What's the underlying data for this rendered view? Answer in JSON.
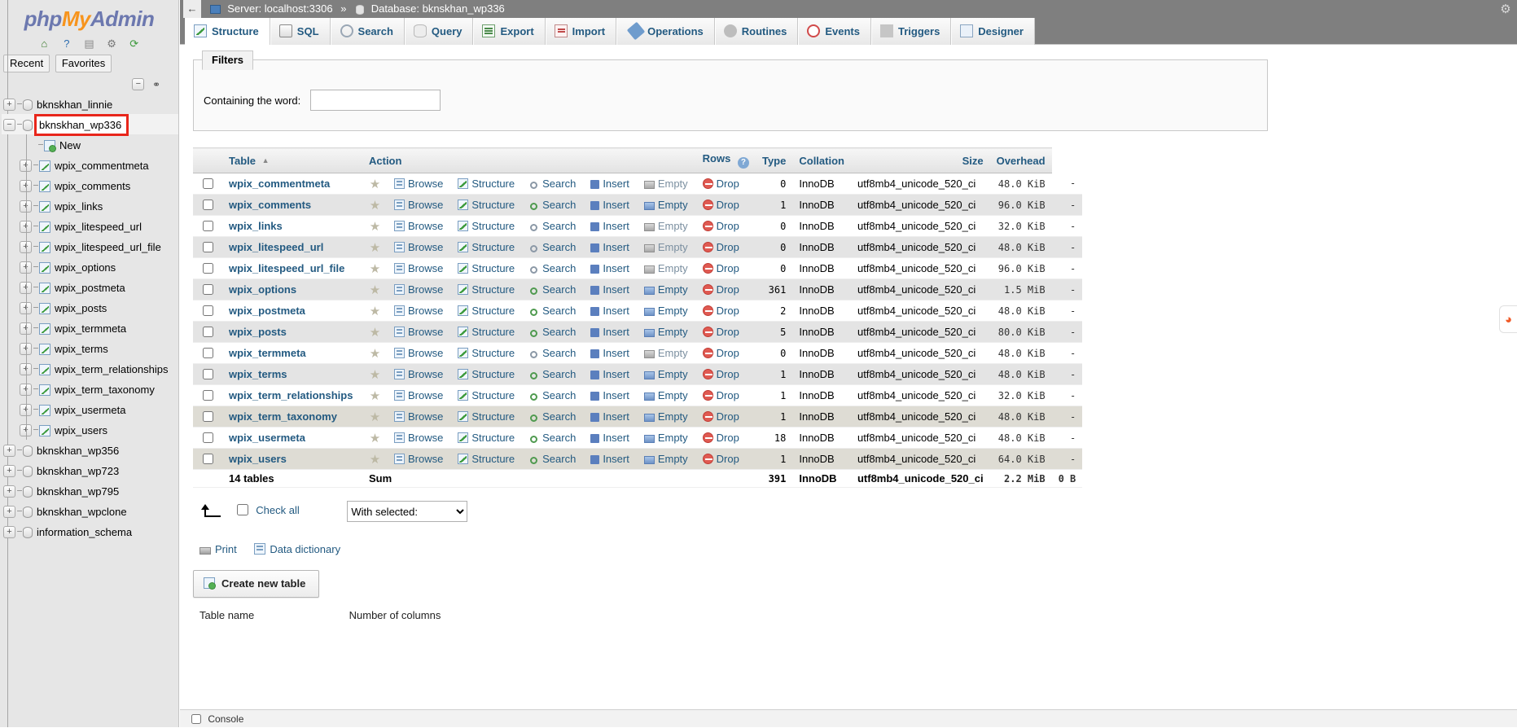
{
  "branding": {
    "logo_php": "php",
    "logo_my": "My",
    "logo_admin": "Admin"
  },
  "sidebar": {
    "icons": [
      {
        "name": "home-icon",
        "glyph": "⌂"
      },
      {
        "name": "help-icon",
        "glyph": "?"
      },
      {
        "name": "documentation-icon",
        "glyph": "▤"
      },
      {
        "name": "settings-gear-icon",
        "glyph": "⚙"
      },
      {
        "name": "reload-icon",
        "glyph": "⟳"
      }
    ],
    "tabs": [
      {
        "label": "Recent"
      },
      {
        "label": "Favorites"
      }
    ],
    "tree_controls": {
      "collapse_label": "−",
      "link_label": "⚭"
    },
    "tree": [
      {
        "label": "bknskhan_linnie",
        "level": 0,
        "expander": "+",
        "type": "db"
      },
      {
        "label": "bknskhan_wp336",
        "level": 0,
        "expander": "−",
        "type": "db",
        "highlight": true,
        "active": true
      },
      {
        "label": "New",
        "level": 1,
        "expander": "",
        "type": "new"
      },
      {
        "label": "wpix_commentmeta",
        "level": 1,
        "expander": "+",
        "type": "table"
      },
      {
        "label": "wpix_comments",
        "level": 1,
        "expander": "+",
        "type": "table"
      },
      {
        "label": "wpix_links",
        "level": 1,
        "expander": "+",
        "type": "table"
      },
      {
        "label": "wpix_litespeed_url",
        "level": 1,
        "expander": "+",
        "type": "table"
      },
      {
        "label": "wpix_litespeed_url_file",
        "level": 1,
        "expander": "+",
        "type": "table"
      },
      {
        "label": "wpix_options",
        "level": 1,
        "expander": "+",
        "type": "table"
      },
      {
        "label": "wpix_postmeta",
        "level": 1,
        "expander": "+",
        "type": "table"
      },
      {
        "label": "wpix_posts",
        "level": 1,
        "expander": "+",
        "type": "table"
      },
      {
        "label": "wpix_termmeta",
        "level": 1,
        "expander": "+",
        "type": "table"
      },
      {
        "label": "wpix_terms",
        "level": 1,
        "expander": "+",
        "type": "table"
      },
      {
        "label": "wpix_term_relationships",
        "level": 1,
        "expander": "+",
        "type": "table"
      },
      {
        "label": "wpix_term_taxonomy",
        "level": 1,
        "expander": "+",
        "type": "table"
      },
      {
        "label": "wpix_usermeta",
        "level": 1,
        "expander": "+",
        "type": "table"
      },
      {
        "label": "wpix_users",
        "level": 1,
        "expander": "+",
        "type": "table"
      },
      {
        "label": "bknskhan_wp356",
        "level": 0,
        "expander": "+",
        "type": "db"
      },
      {
        "label": "bknskhan_wp723",
        "level": 0,
        "expander": "+",
        "type": "db"
      },
      {
        "label": "bknskhan_wp795",
        "level": 0,
        "expander": "+",
        "type": "db"
      },
      {
        "label": "bknskhan_wpclone",
        "level": 0,
        "expander": "+",
        "type": "db"
      },
      {
        "label": "information_schema",
        "level": 0,
        "expander": "+",
        "type": "db"
      }
    ]
  },
  "breadcrumb": {
    "back_glyph": "←",
    "server": "Server: localhost:3306",
    "separator": "»",
    "database": "Database: bknskhan_wp336"
  },
  "navtabs": [
    {
      "label": "Structure",
      "icon": "structure-icon",
      "active": true
    },
    {
      "label": "SQL",
      "icon": "sql-icon",
      "active": false
    },
    {
      "label": "Search",
      "icon": "search-icon",
      "active": false
    },
    {
      "label": "Query",
      "icon": "query-icon",
      "active": false
    },
    {
      "label": "Export",
      "icon": "export-icon",
      "active": false
    },
    {
      "label": "Import",
      "icon": "import-icon",
      "active": false
    },
    {
      "label": "Operations",
      "icon": "operations-icon",
      "active": false
    },
    {
      "label": "Routines",
      "icon": "routines-icon",
      "active": false
    },
    {
      "label": "Events",
      "icon": "events-icon",
      "active": false
    },
    {
      "label": "Triggers",
      "icon": "triggers-icon",
      "active": false
    },
    {
      "label": "Designer",
      "icon": "designer-icon",
      "active": false
    }
  ],
  "filters": {
    "legend": "Filters",
    "containing_label": "Containing the word:",
    "containing_value": "",
    "containing_placeholder": ""
  },
  "tables_table": {
    "headers": {
      "table": "Table",
      "sort_arrow": "▲",
      "action": "Action",
      "rows": "Rows",
      "rows_help": "?",
      "type": "Type",
      "collation": "Collation",
      "size": "Size",
      "overhead": "Overhead"
    },
    "actions": {
      "browse": "Browse",
      "structure": "Structure",
      "search": "Search",
      "insert": "Insert",
      "empty": "Empty",
      "drop": "Drop",
      "star": "★"
    },
    "rows": [
      {
        "name": "wpix_commentmeta",
        "rows": "0",
        "type": "InnoDB",
        "collation": "utf8mb4_unicode_520_ci",
        "size": "48.0 KiB",
        "overhead": "-",
        "empty_active": false,
        "search_active": false
      },
      {
        "name": "wpix_comments",
        "rows": "1",
        "type": "InnoDB",
        "collation": "utf8mb4_unicode_520_ci",
        "size": "96.0 KiB",
        "overhead": "-",
        "empty_active": true,
        "search_active": true
      },
      {
        "name": "wpix_links",
        "rows": "0",
        "type": "InnoDB",
        "collation": "utf8mb4_unicode_520_ci",
        "size": "32.0 KiB",
        "overhead": "-",
        "empty_active": false,
        "search_active": false
      },
      {
        "name": "wpix_litespeed_url",
        "rows": "0",
        "type": "InnoDB",
        "collation": "utf8mb4_unicode_520_ci",
        "size": "48.0 KiB",
        "overhead": "-",
        "empty_active": false,
        "search_active": false
      },
      {
        "name": "wpix_litespeed_url_file",
        "rows": "0",
        "type": "InnoDB",
        "collation": "utf8mb4_unicode_520_ci",
        "size": "96.0 KiB",
        "overhead": "-",
        "empty_active": false,
        "search_active": false
      },
      {
        "name": "wpix_options",
        "rows": "361",
        "type": "InnoDB",
        "collation": "utf8mb4_unicode_520_ci",
        "size": "1.5 MiB",
        "overhead": "-",
        "empty_active": true,
        "search_active": true
      },
      {
        "name": "wpix_postmeta",
        "rows": "2",
        "type": "InnoDB",
        "collation": "utf8mb4_unicode_520_ci",
        "size": "48.0 KiB",
        "overhead": "-",
        "empty_active": true,
        "search_active": true
      },
      {
        "name": "wpix_posts",
        "rows": "5",
        "type": "InnoDB",
        "collation": "utf8mb4_unicode_520_ci",
        "size": "80.0 KiB",
        "overhead": "-",
        "empty_active": true,
        "search_active": true
      },
      {
        "name": "wpix_termmeta",
        "rows": "0",
        "type": "InnoDB",
        "collation": "utf8mb4_unicode_520_ci",
        "size": "48.0 KiB",
        "overhead": "-",
        "empty_active": false,
        "search_active": false
      },
      {
        "name": "wpix_terms",
        "rows": "1",
        "type": "InnoDB",
        "collation": "utf8mb4_unicode_520_ci",
        "size": "48.0 KiB",
        "overhead": "-",
        "empty_active": true,
        "search_active": true
      },
      {
        "name": "wpix_term_relationships",
        "rows": "1",
        "type": "InnoDB",
        "collation": "utf8mb4_unicode_520_ci",
        "size": "32.0 KiB",
        "overhead": "-",
        "empty_active": true,
        "search_active": true
      },
      {
        "name": "wpix_term_taxonomy",
        "rows": "1",
        "type": "InnoDB",
        "collation": "utf8mb4_unicode_520_ci",
        "size": "48.0 KiB",
        "overhead": "-",
        "empty_active": true,
        "search_active": true,
        "hovered": true
      },
      {
        "name": "wpix_usermeta",
        "rows": "18",
        "type": "InnoDB",
        "collation": "utf8mb4_unicode_520_ci",
        "size": "48.0 KiB",
        "overhead": "-",
        "empty_active": true,
        "search_active": true
      },
      {
        "name": "wpix_users",
        "rows": "1",
        "type": "InnoDB",
        "collation": "utf8mb4_unicode_520_ci",
        "size": "64.0 KiB",
        "overhead": "-",
        "empty_active": true,
        "search_active": true,
        "hovered": true
      }
    ],
    "summary": {
      "tables_count": "14 tables",
      "sum_label": "Sum",
      "rows_total": "391",
      "type": "InnoDB",
      "collation": "utf8mb4_unicode_520_ci",
      "size": "2.2 MiB",
      "overhead": "0 B"
    }
  },
  "bottom_controls": {
    "check_all": "Check all",
    "with_selected_label": "With selected:",
    "with_selected_options": [
      "With selected:"
    ]
  },
  "links": {
    "print": "Print",
    "data_dictionary": "Data dictionary"
  },
  "create_table": {
    "button_label": "Create new table",
    "table_name_label": "Table name",
    "num_columns_label": "Number of columns"
  },
  "console": {
    "label": "Console"
  },
  "misc": {
    "gear_glyph": "⚙",
    "right_widget_glyph": "◕"
  },
  "colors": {
    "link": "#235a81",
    "highlight_outline": "#e8261b",
    "breadcrumb_bg": "#7f7f7f",
    "sidebar_bg": "#e6e6e6",
    "row_even": "#e4e4e4",
    "row_hover": "#dedcd4"
  }
}
